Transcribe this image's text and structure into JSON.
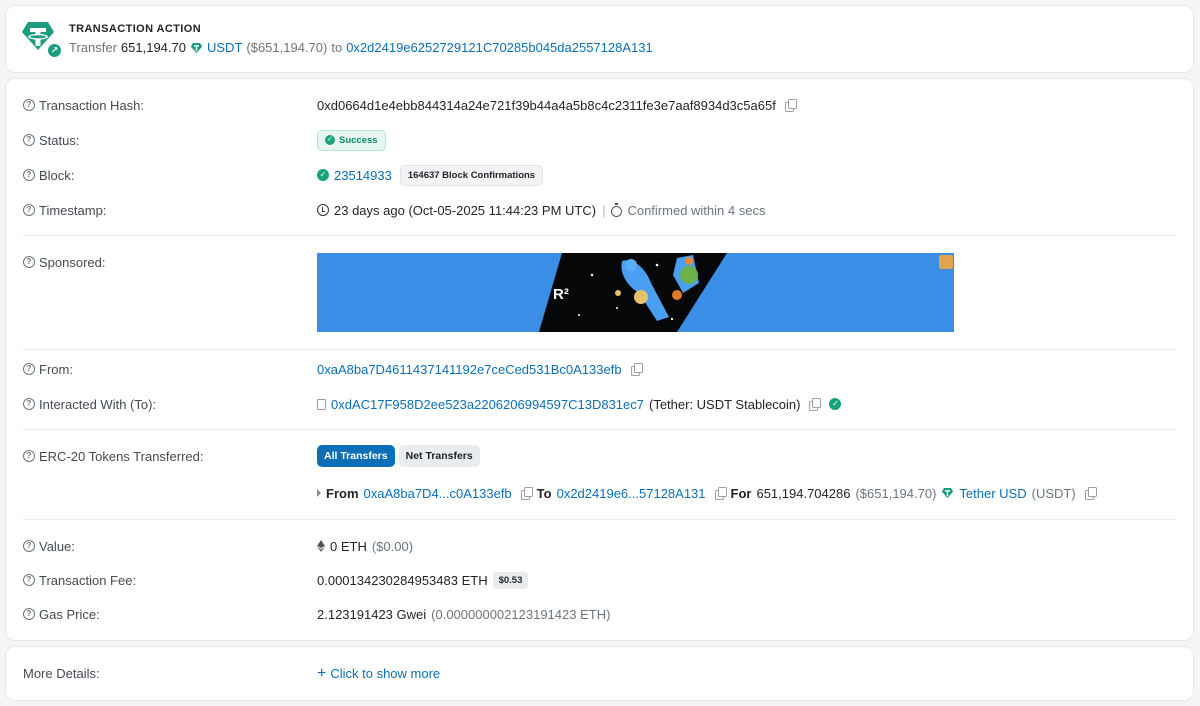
{
  "action": {
    "title": "TRANSACTION ACTION",
    "verb": "Transfer",
    "amount": "651,194.70",
    "token": "USDT",
    "usd": "($651,194.70)",
    "to_word": "to",
    "to_address": "0x2d2419e6252729121C70285b045da2557128A131"
  },
  "rows": {
    "tx_hash": {
      "label": "Transaction Hash:",
      "value": "0xd0664d1e4ebb844314a24e721f39b44a4a5b8c4c2311fe3e7aaf8934d3c5a65f"
    },
    "status": {
      "label": "Status:",
      "value": "Success"
    },
    "block": {
      "label": "Block:",
      "value": "23514933",
      "confirmations": "164637 Block Confirmations"
    },
    "timestamp": {
      "label": "Timestamp:",
      "value": "23 days ago (Oct-05-2025 11:44:23 PM UTC)",
      "sep": "|",
      "confirmed": "Confirmed within 4 secs"
    },
    "sponsored": {
      "label": "Sponsored:"
    },
    "from": {
      "label": "From:",
      "value": "0xaA8ba7D4611437141192e7ceCed531Bc0A133efb"
    },
    "interacted": {
      "label": "Interacted With (To):",
      "value": "0xdAC17F958D2ee523a2206206994597C13D831ec7",
      "name": "(Tether: USDT Stablecoin)"
    },
    "erc20": {
      "label": "ERC-20 Tokens Transferred:",
      "tab_all": "All Transfers",
      "tab_net": "Net Transfers",
      "from_word": "From",
      "from_addr": "0xaA8ba7D4...c0A133efb",
      "to_word": "To",
      "to_addr": "0x2d2419e6...57128A131",
      "for_word": "For",
      "amount": "651,194.704286",
      "usd": "($651,194.70)",
      "token_name": "Tether USD",
      "token_symbol": "(USDT)"
    },
    "value": {
      "label": "Value:",
      "amount": "0 ETH",
      "usd": "($0.00)"
    },
    "fee": {
      "label": "Transaction Fee:",
      "amount": "0.000134230284953483 ETH",
      "usd": "$0.53"
    },
    "gas": {
      "label": "Gas Price:",
      "amount": "2.123191423 Gwei",
      "eth": "(0.000000002123191423 ETH)"
    }
  },
  "more": {
    "label": "More Details:",
    "link": "Click to show more"
  },
  "colors": {
    "link": "#0b6fb8",
    "tether": "#1e9c7f",
    "success": "#1aa37a",
    "banner": "#3b8ee6"
  }
}
